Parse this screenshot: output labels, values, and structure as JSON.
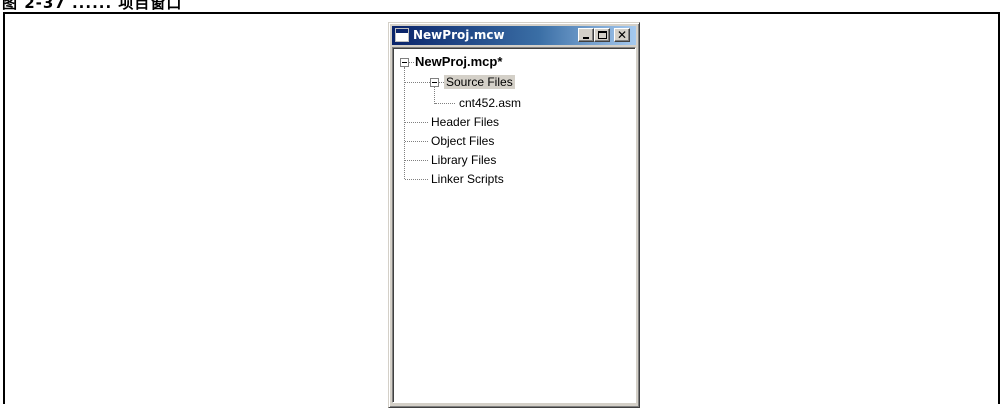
{
  "caption": "图 2-37 ...... 项目窗口",
  "window": {
    "title": "NewProj.mcw",
    "buttons": {
      "minimize": "minimize",
      "maximize": "maximize",
      "close": "✕"
    }
  },
  "tree": {
    "root": "NewProj.mcp*",
    "source_files": "Source Files",
    "source_children": [
      "cnt452.asm"
    ],
    "folders": [
      "Header Files",
      "Object Files",
      "Library Files",
      "Linker Scripts"
    ],
    "selected": "Source Files"
  },
  "colors": {
    "title_start": "#0a246a",
    "title_end": "#a6caf0",
    "window_face": "#d4d0c8"
  }
}
